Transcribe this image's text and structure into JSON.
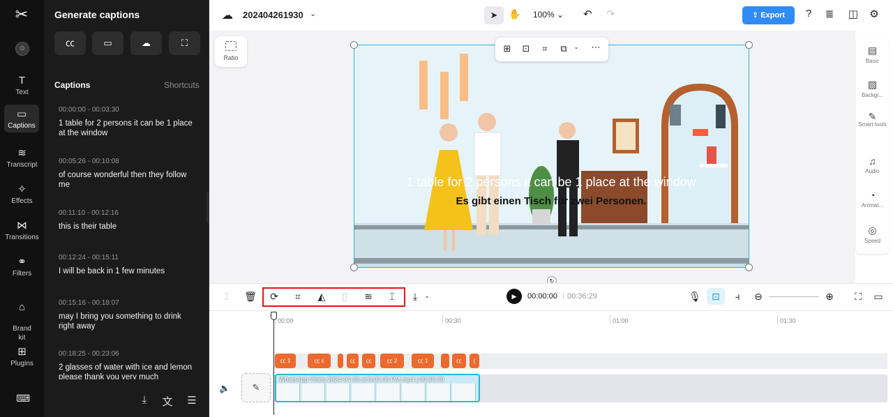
{
  "rail": {
    "items": [
      {
        "label": "Text",
        "icon": "T"
      },
      {
        "label": "Captions",
        "icon": "▭"
      },
      {
        "label": "Transcript",
        "icon": "≋"
      },
      {
        "label": "Effects",
        "icon": "✧"
      },
      {
        "label": "Transitions",
        "icon": "⋈"
      },
      {
        "label": "Filters",
        "icon": "⚭"
      },
      {
        "label": "Brand\nkit",
        "icon": "⌂"
      },
      {
        "label": "Plugins",
        "icon": "⊞"
      }
    ]
  },
  "panel": {
    "title": "Generate captions",
    "captions_heading": "Captions",
    "shortcuts_label": "Shortcuts",
    "captions": [
      {
        "time": "00:00:00 - 00:03:30",
        "text": "1 table for 2 persons it can be 1 place at the window"
      },
      {
        "time": "00:05:26 - 00:10:08",
        "text": "of course wonderful then they follow me"
      },
      {
        "time": "00:11:10 - 00:12:16",
        "text": "this is their table"
      },
      {
        "time": "00:12:24 - 00:15:11",
        "text": "I will be back in 1 few minutes"
      },
      {
        "time": "00:15:16 - 00:18:07",
        "text": "may I bring you something to drink right away"
      },
      {
        "time": "00:18:25 - 00:23:06",
        "text": "2 glasses of water with ice and lemon please thank you very much"
      }
    ]
  },
  "topbar": {
    "project_title": "202404261930",
    "zoom": "100%",
    "export_label": "Export"
  },
  "canvas": {
    "ratio_label": "Ratio",
    "subtitle_line1": "1 table for 2 persons it can be 1 place at the window",
    "subtitle_line2": "Es gibt einen Tisch für zwei Personen."
  },
  "right_panel": {
    "items": [
      {
        "label": "Basic",
        "icon": "▤"
      },
      {
        "label": "Backgr...",
        "icon": "▨"
      },
      {
        "label": "Smart tools",
        "icon": "✎"
      },
      {
        "label": "Audio",
        "icon": "♫"
      },
      {
        "label": "Animat...",
        "icon": "◔"
      },
      {
        "label": "Speed",
        "icon": "◎"
      }
    ]
  },
  "timeline": {
    "current_time": "00:00:00",
    "total_time": "00:36:29",
    "ruler": [
      "00:00",
      "00:30",
      "01:00",
      "01:30"
    ],
    "clip_title": "WhatsApp Video 2024-04-26 at 8.02.06 PM.mp4 | 00:36:29",
    "chips": [
      "1",
      "c",
      "",
      "",
      "",
      "2",
      "1",
      "",
      "",
      ""
    ]
  }
}
